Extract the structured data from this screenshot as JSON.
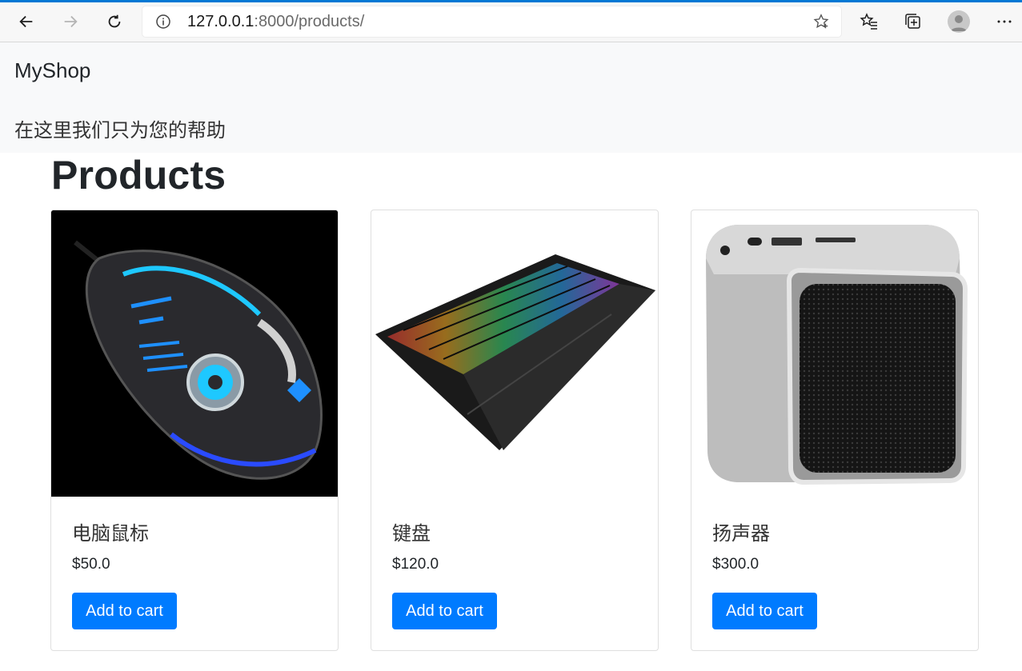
{
  "browser": {
    "url_host": "127.0.0.1",
    "url_rest": ":8000/products/"
  },
  "header": {
    "brand": "MyShop",
    "tagline": "在这里我们只为您的帮助"
  },
  "main": {
    "title": "Products",
    "products": [
      {
        "name": "电脑鼠标",
        "price": "$50.0",
        "button_label": "Add to cart",
        "image_icon": "gaming-mouse-image"
      },
      {
        "name": "键盘",
        "price": "$120.0",
        "button_label": "Add to cart",
        "image_icon": "keyboard-image"
      },
      {
        "name": "扬声器",
        "price": "$300.0",
        "button_label": "Add to cart",
        "image_icon": "speaker-image"
      }
    ]
  },
  "colors": {
    "accent": "#007bff",
    "header_bg": "#f8f9fa",
    "browser_accent": "#0078d4"
  }
}
